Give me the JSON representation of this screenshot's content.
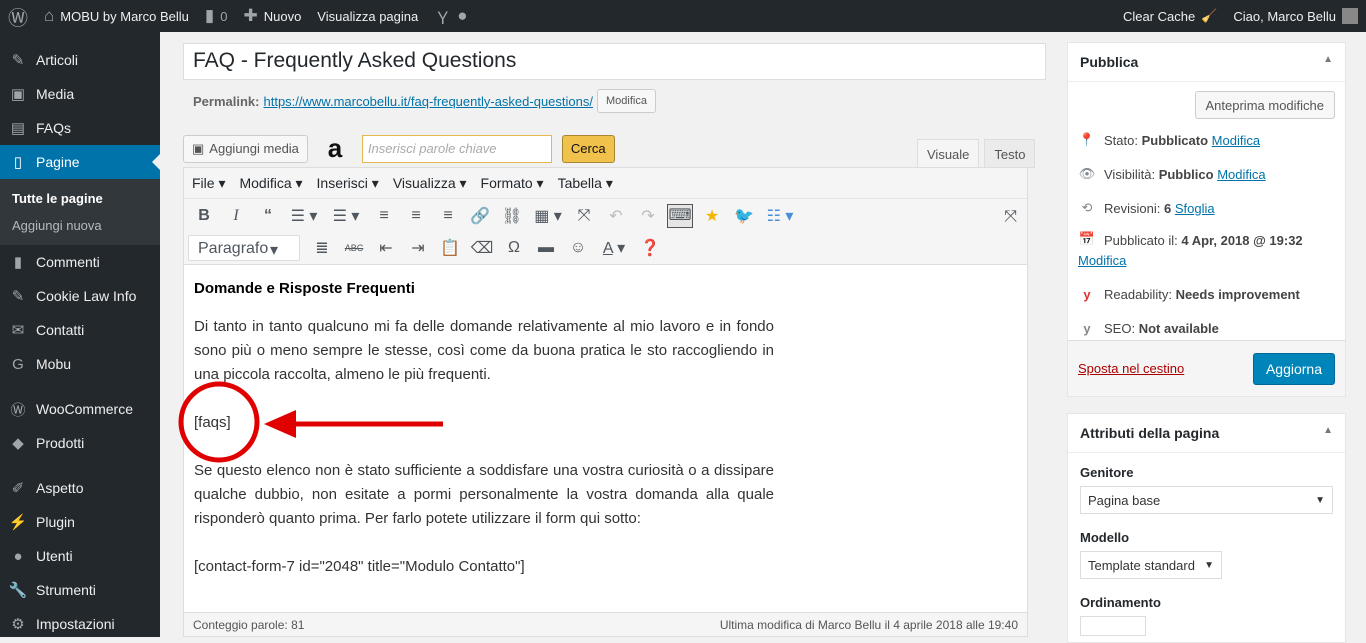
{
  "adminbar": {
    "site": "MOBU by Marco Bellu",
    "comments": "0",
    "new": "Nuovo",
    "view": "Visualizza pagina",
    "clear_cache": "Clear Cache",
    "greeting": "Ciao, Marco Bellu"
  },
  "sidebar": {
    "items": [
      "Articoli",
      "Media",
      "FAQs",
      "Pagine",
      "Commenti",
      "Cookie Law Info",
      "Contatti",
      "Mobu",
      "WooCommerce",
      "Prodotti",
      "Aspetto",
      "Plugin",
      "Utenti",
      "Strumenti",
      "Impostazioni"
    ],
    "sub": [
      "Tutte le pagine",
      "Aggiungi nuova"
    ]
  },
  "post": {
    "title": "FAQ - Frequently Asked Questions",
    "permalink_label": "Permalink:",
    "permalink": "https://www.marcobellu.it/faq-frequently-asked-questions/",
    "edit": "Modifica"
  },
  "media": {
    "add": "Aggiungi media",
    "kw_placeholder": "Inserisci parole chiave",
    "search": "Cerca"
  },
  "tabs": {
    "visual": "Visuale",
    "text": "Testo"
  },
  "menubar": [
    "File",
    "Modifica",
    "Inserisci",
    "Visualizza",
    "Formato",
    "Tabella"
  ],
  "format": "Paragrafo",
  "content": {
    "heading": "Domande e Risposte Frequenti",
    "p1": "Di tanto in tanto qualcuno mi fa delle domande relativamente al mio lavoro e in fondo sono più o meno sempre le stesse, così come da buona pratica le sto raccogliendo in una piccola raccolta, almeno le più frequenti.",
    "shortcode": "[faqs]",
    "p2": "Se questo elenco non è stato sufficiente a soddisfare una vostra curiosità o a dissipare qualche dubbio, non esitate a pormi personalmente la vostra domanda alla quale risponderò quanto prima. Per farlo potete utilizzare il form qui sotto:",
    "form": "[contact-form-7 id=\"2048\" title=\"Modulo Contatto\"]"
  },
  "footer": {
    "words": "Conteggio parole: 81",
    "modified": "Ultima modifica di Marco Bellu il 4 aprile 2018 alle 19:40"
  },
  "publish": {
    "title": "Pubblica",
    "preview": "Anteprima modifiche",
    "status_label": "Stato:",
    "status": "Pubblicato",
    "visibility_label": "Visibilità:",
    "visibility": "Pubblico",
    "revisions_label": "Revisioni:",
    "revisions": "6",
    "browse": "Sfoglia",
    "published_label": "Pubblicato il:",
    "published": "4 Apr, 2018 @ 19:32",
    "edit": "Modifica",
    "readability_label": "Readability:",
    "readability": "Needs improvement",
    "seo_label": "SEO:",
    "seo": "Not available",
    "trash": "Sposta nel cestino",
    "update": "Aggiorna"
  },
  "attributes": {
    "title": "Attributi della pagina",
    "parent_label": "Genitore",
    "parent": "Pagina base",
    "template_label": "Modello",
    "template": "Template standard",
    "order_label": "Ordinamento"
  },
  "colors": {
    "accent": "#0073aa",
    "annotation": "#e00000"
  }
}
